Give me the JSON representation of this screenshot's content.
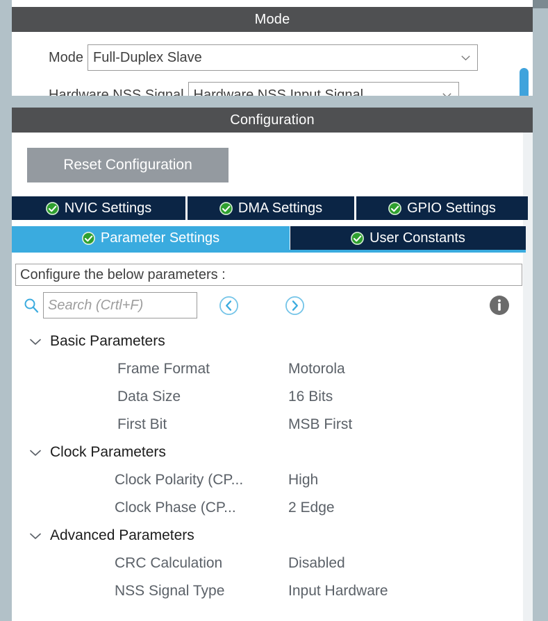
{
  "window": {
    "frame_color": "#b2c1c8",
    "header_color": "#4f5052"
  },
  "mode_panel": {
    "title": "Mode",
    "rows": [
      {
        "label": "Mode",
        "value": "Full-Duplex Slave",
        "icon": "chevron-down-icon"
      },
      {
        "label": "Hardware NSS Signal",
        "value": "Hardware NSS Input Signal",
        "icon": "chevron-down-icon"
      }
    ],
    "scrollbar": {
      "track_color": "#d9e8f3",
      "thumb_color": "#3fa3dc"
    }
  },
  "config_panel": {
    "title": "Configuration",
    "reset_button": {
      "label": "Reset Configuration",
      "bg_color": "#949aa0"
    },
    "tabs_row_1": [
      {
        "label": "NVIC Settings",
        "icon": "check-circle-icon",
        "active": false
      },
      {
        "label": "DMA Settings",
        "icon": "check-circle-icon",
        "active": false
      },
      {
        "label": "GPIO Settings",
        "icon": "check-circle-icon",
        "active": false
      }
    ],
    "tabs_row_2": [
      {
        "label": "Parameter Settings",
        "icon": "check-circle-icon",
        "active": true
      },
      {
        "label": "User Constants",
        "icon": "check-circle-icon",
        "active": false
      }
    ],
    "tab_colors": {
      "inactive_bg": "#0b2545",
      "active_bg": "#3aabdf",
      "check_green": "#2aa02a"
    },
    "hint": "Configure the below parameters :",
    "search": {
      "placeholder": "Search (Crtl+F)",
      "value": "",
      "icon": "search-icon",
      "accent_color": "#3aabdf"
    },
    "nav": {
      "prev_icon": "chevron-left-circle-icon",
      "next_icon": "chevron-right-circle-icon"
    },
    "info": {
      "icon": "info-circle-icon",
      "color": "#6b6b6b"
    },
    "parameter_groups": [
      {
        "label": "Basic Parameters",
        "expanded": true,
        "expander_icon": "chevron-down-icon",
        "rows": [
          {
            "name": "Frame Format",
            "value": "Motorola"
          },
          {
            "name": "Data Size",
            "value": "16 Bits"
          },
          {
            "name": "First Bit",
            "value": "MSB First"
          }
        ]
      },
      {
        "label": "Clock Parameters",
        "expanded": true,
        "expander_icon": "chevron-down-icon",
        "rows": [
          {
            "name": "Clock Polarity (CP...",
            "value": "High"
          },
          {
            "name": "Clock Phase (CP...",
            "value": "2 Edge"
          }
        ]
      },
      {
        "label": "Advanced Parameters",
        "expanded": true,
        "expander_icon": "chevron-down-icon",
        "rows": [
          {
            "name": "CRC Calculation",
            "value": "Disabled"
          },
          {
            "name": "NSS Signal Type",
            "value": "Input Hardware"
          }
        ]
      }
    ]
  }
}
